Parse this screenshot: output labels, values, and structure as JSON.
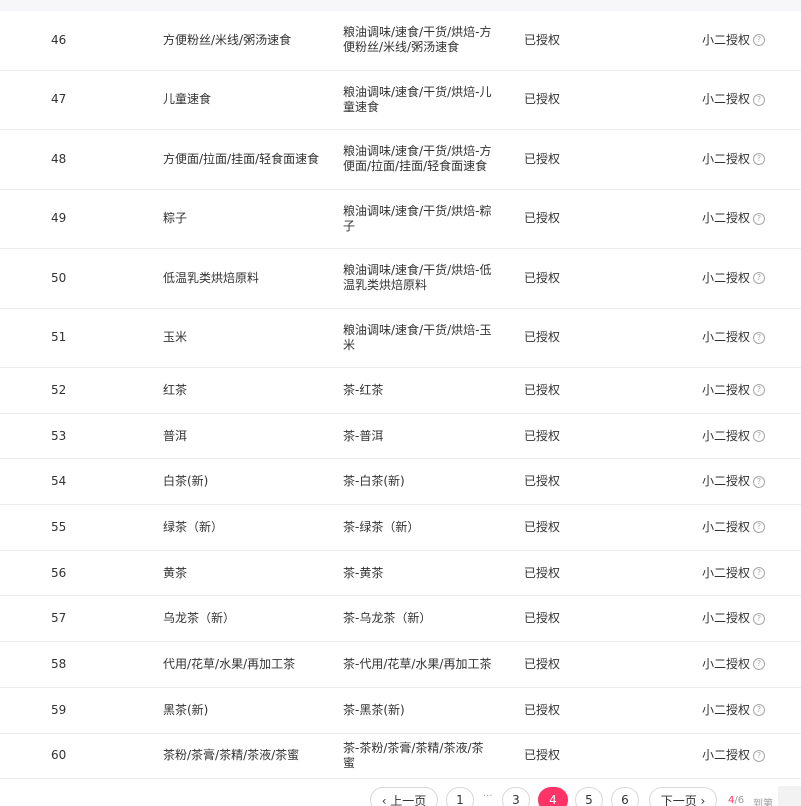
{
  "rows": [
    {
      "idx": "46",
      "name": "方便粉丝/米线/粥汤速食",
      "path": "粮油调味/速食/干货/烘焙-方便粉丝/米线/粥汤速食",
      "status": "已授权",
      "auth": "小二授权",
      "tall": true
    },
    {
      "idx": "47",
      "name": "儿童速食",
      "path": "粮油调味/速食/干货/烘焙-儿童速食",
      "status": "已授权",
      "auth": "小二授权",
      "tall": true
    },
    {
      "idx": "48",
      "name": "方便面/拉面/挂面/轻食面速食",
      "path": "粮油调味/速食/干货/烘焙-方便面/拉面/挂面/轻食面速食",
      "status": "已授权",
      "auth": "小二授权",
      "tall": true
    },
    {
      "idx": "49",
      "name": "粽子",
      "path": "粮油调味/速食/干货/烘焙-粽子",
      "status": "已授权",
      "auth": "小二授权",
      "tall": true
    },
    {
      "idx": "50",
      "name": "低温乳类烘焙原料",
      "path": "粮油调味/速食/干货/烘焙-低温乳类烘焙原料",
      "status": "已授权",
      "auth": "小二授权",
      "tall": true
    },
    {
      "idx": "51",
      "name": "玉米",
      "path": "粮油调味/速食/干货/烘焙-玉米",
      "status": "已授权",
      "auth": "小二授权",
      "tall": true
    },
    {
      "idx": "52",
      "name": "红茶",
      "path": "茶-红茶",
      "status": "已授权",
      "auth": "小二授权",
      "tall": false
    },
    {
      "idx": "53",
      "name": "普洱",
      "path": "茶-普洱",
      "status": "已授权",
      "auth": "小二授权",
      "tall": false
    },
    {
      "idx": "54",
      "name": "白茶(新)",
      "path": "茶-白茶(新)",
      "status": "已授权",
      "auth": "小二授权",
      "tall": false
    },
    {
      "idx": "55",
      "name": "绿茶（新）",
      "path": "茶-绿茶（新）",
      "status": "已授权",
      "auth": "小二授权",
      "tall": false
    },
    {
      "idx": "56",
      "name": "黄茶",
      "path": "茶-黄茶",
      "status": "已授权",
      "auth": "小二授权",
      "tall": false
    },
    {
      "idx": "57",
      "name": "乌龙茶（新）",
      "path": "茶-乌龙茶（新）",
      "status": "已授权",
      "auth": "小二授权",
      "tall": false
    },
    {
      "idx": "58",
      "name": "代用/花草/水果/再加工茶",
      "path": "茶-代用/花草/水果/再加工茶",
      "status": "已授权",
      "auth": "小二授权",
      "tall": false
    },
    {
      "idx": "59",
      "name": "黑茶(新)",
      "path": "茶-黑茶(新)",
      "status": "已授权",
      "auth": "小二授权",
      "tall": false
    },
    {
      "idx": "60",
      "name": "茶粉/茶膏/茶精/茶液/茶蜜",
      "path": "茶-茶粉/茶膏/茶精/茶液/茶蜜",
      "status": "已授权",
      "auth": "小二授权",
      "tall": false
    }
  ],
  "icons": {
    "help": "question-circle-icon"
  },
  "pagination": {
    "prev_label": "‹ 上一页",
    "next_label": "下一页 ›",
    "pages": [
      "1",
      "3",
      "4",
      "5",
      "6"
    ],
    "active_page": "4",
    "ellipsis": "···",
    "current": "4",
    "total_suffix": "/6",
    "goto_label": "到第"
  },
  "colors": {
    "accent": "#ff3366",
    "border": "#ebebeb",
    "muted": "#999999"
  }
}
